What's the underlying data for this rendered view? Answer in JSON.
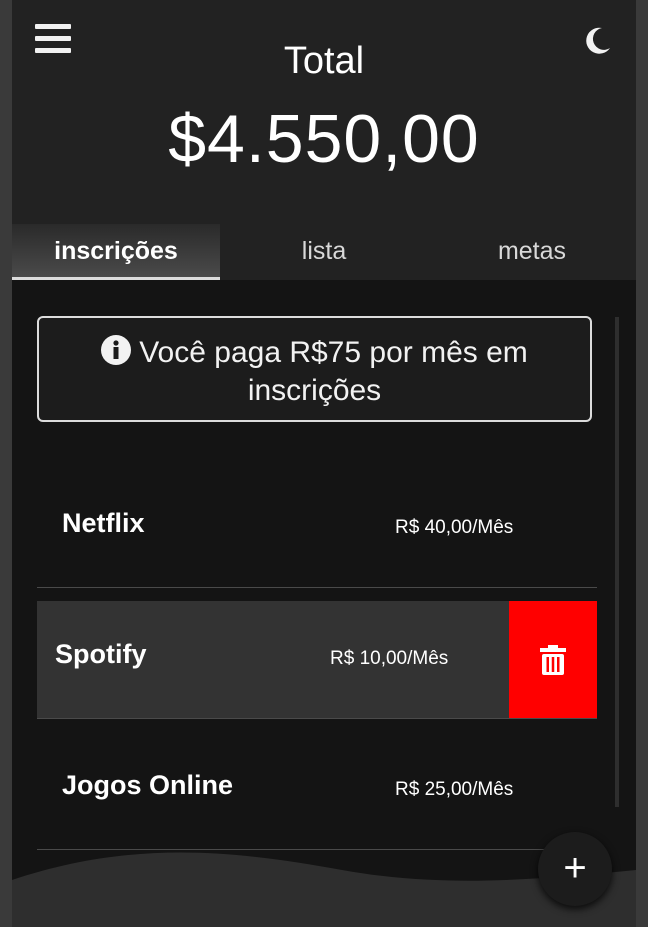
{
  "header": {
    "total_label": "Total",
    "total_value": "$4.550,00"
  },
  "tabs": [
    {
      "label": "inscrições",
      "active": true
    },
    {
      "label": "lista",
      "active": false
    },
    {
      "label": "metas",
      "active": false
    }
  ],
  "info": {
    "text": "Você paga R$75 por mês em inscrições",
    "icon": "info-icon"
  },
  "subscriptions": [
    {
      "name": "Netflix",
      "price": "R$ 40,00/Mês"
    },
    {
      "name": "Spotify",
      "price": "R$ 10,00/Mês"
    },
    {
      "name": "Jogos Online",
      "price": "R$ 25,00/Mês"
    }
  ],
  "fab": {
    "label": "+"
  },
  "colors": {
    "background": "#141414",
    "header": "#222222",
    "delete": "#ff0000",
    "swiped_row": "#333333"
  }
}
